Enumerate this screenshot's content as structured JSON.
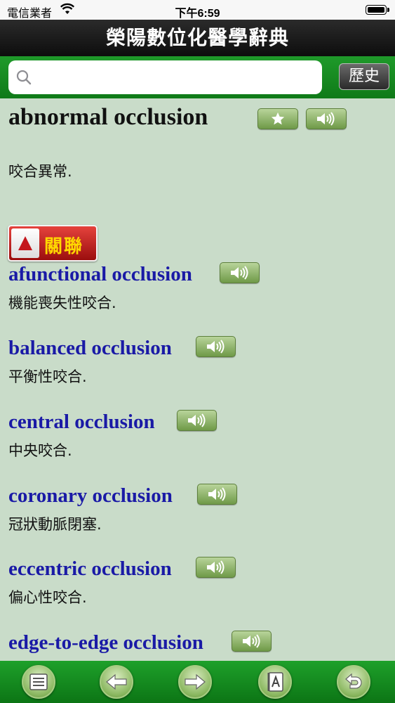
{
  "status_bar": {
    "carrier": "電信業者",
    "time": "下午6:59"
  },
  "app": {
    "title": "榮陽數位化醫學辭典"
  },
  "search": {
    "placeholder": "",
    "value": "",
    "history_label": "歷史"
  },
  "entry": {
    "term": "abnormal occlusion",
    "definition": "咬合異常."
  },
  "related": {
    "label": "關聯",
    "items": [
      {
        "term": "afunctional occlusion",
        "definition": "機能喪失性咬合."
      },
      {
        "term": "balanced occlusion",
        "definition": "平衡性咬合."
      },
      {
        "term": "central occlusion",
        "definition": "中央咬合."
      },
      {
        "term": "coronary occlusion",
        "definition": "冠狀動脈閉塞."
      },
      {
        "term": "eccentric occlusion",
        "definition": "偏心性咬合."
      },
      {
        "term": "edge-to-edge occlusion",
        "definition": ""
      }
    ]
  },
  "toolbar": {
    "icons": [
      "list-icon",
      "back-arrow-icon",
      "forward-arrow-icon",
      "dictionary-book-icon",
      "return-icon"
    ]
  },
  "colors": {
    "term_blue": "#1a1aa6",
    "bar_green": "#1a8f24",
    "related_red": "#b81a16"
  }
}
